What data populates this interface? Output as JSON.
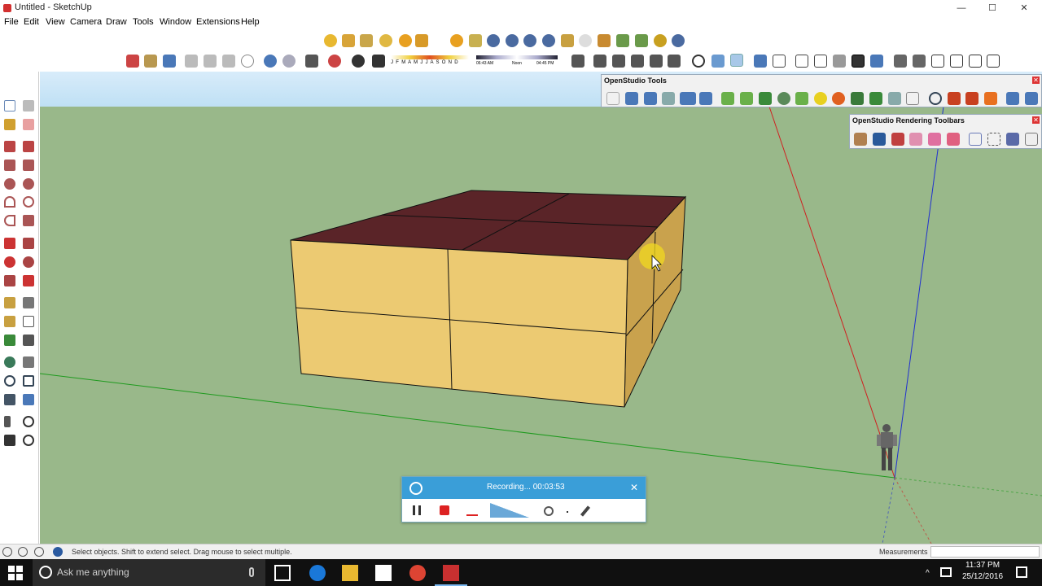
{
  "window": {
    "title": "Untitled - SketchUp",
    "controls": [
      "—",
      "☐",
      "✕"
    ]
  },
  "menu": [
    "File",
    "Edit",
    "View",
    "Camera",
    "Draw",
    "Tools",
    "Window",
    "Extensions",
    "Help"
  ],
  "shadow": {
    "months": "J F M A M J J A S O N D",
    "time_start": "06:43 AM",
    "time_noon": "Noon",
    "time_end": "04:45 PM"
  },
  "panels": {
    "openstudio_tools": {
      "title": "OpenStudio Tools",
      "close": "✕"
    },
    "rendering": {
      "title": "OpenStudio Rendering Toolbars",
      "close": "✕"
    }
  },
  "recorder": {
    "status": "Recording... 00:03:53",
    "close": "✕"
  },
  "statusbar": {
    "hint": "Select objects. Shift to extend select. Drag mouse to select multiple.",
    "measurements_label": "Measurements",
    "measurements_value": ""
  },
  "taskbar": {
    "search_placeholder": "Ask me anything",
    "time": "11:37 PM",
    "date": "25/12/2016"
  },
  "colors": {
    "ground": "#99b88a",
    "sky": "#cfe7f7",
    "roof": "#5a2428",
    "wall": "#ecca72",
    "wall_side": "#c9a24d",
    "recorder_header": "#3a9ed8",
    "taskbar": "#101010"
  }
}
